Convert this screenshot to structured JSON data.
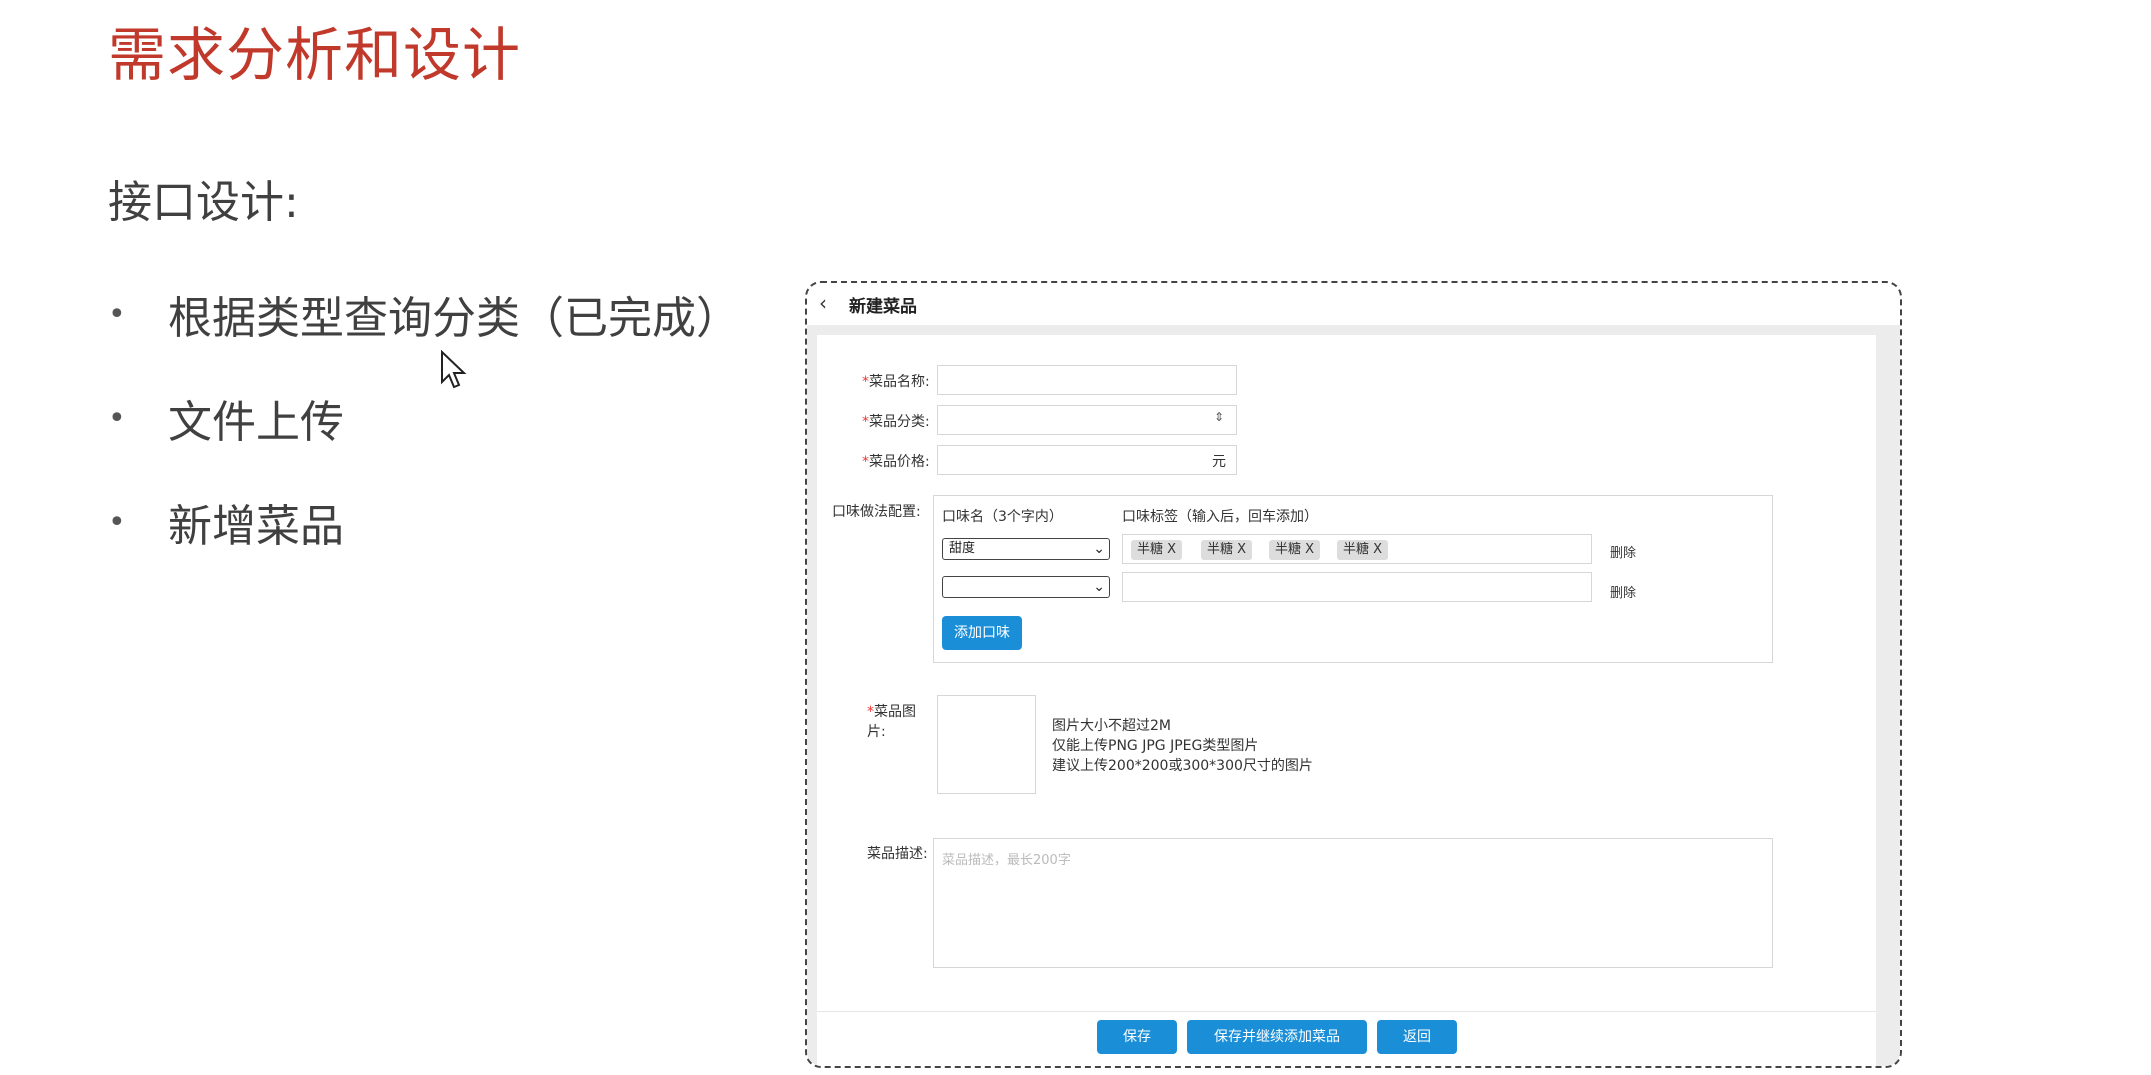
{
  "slide": {
    "title": "需求分析和设计",
    "section_heading": "接口设计:",
    "bullets": [
      {
        "text": "根据类型查询分类（已完成）"
      },
      {
        "text": "文件上传"
      },
      {
        "text": "新增菜品"
      }
    ]
  },
  "form": {
    "page_title": "新建菜品",
    "required_mark": "*",
    "name_label": "菜品名称:",
    "name_value": "",
    "category_label": "菜品分类:",
    "category_value": "",
    "category_arrows": "⇕",
    "price_label": "菜品价格:",
    "price_value": "",
    "price_suffix": "元",
    "flavor_label": "口味做法配置:",
    "flavor_name_head": "口味名（3个字内）",
    "flavor_tags_head": "口味标签（输入后，回车添加）",
    "flavor_rows": [
      {
        "name": "甜度",
        "tags": [
          "半糖 X",
          "半糖 X",
          "半糖 X",
          "半糖 X"
        ],
        "delete": "删除"
      },
      {
        "name": "",
        "tags": [],
        "delete": "删除"
      }
    ],
    "add_flavor_button": "添加口味",
    "image_label_line1": "菜品图",
    "image_label_line2": "片:",
    "image_hints": [
      "图片大小不超过2M",
      "仅能上传PNG JPG JPEG类型图片",
      "建议上传200*200或300*300尺寸的图片"
    ],
    "desc_label": "菜品描述:",
    "desc_placeholder": "菜品描述，最长200字",
    "buttons": {
      "save": "保存",
      "save_continue": "保存并继续添加菜品",
      "back": "返回"
    }
  },
  "colors": {
    "title_red": "#c0392b",
    "button_blue": "#1a8fd8"
  }
}
